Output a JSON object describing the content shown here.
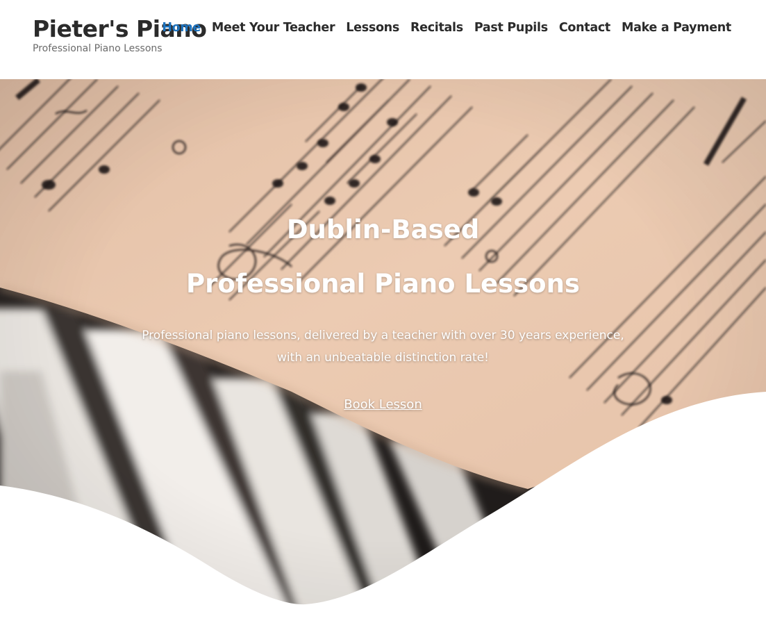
{
  "site": {
    "title": "Pieter's Piano",
    "tagline": "Professional Piano Lessons"
  },
  "nav": {
    "items": [
      {
        "label": "Home",
        "active": true
      },
      {
        "label": "Meet Your Teacher"
      },
      {
        "label": "Lessons"
      },
      {
        "label": "Recitals"
      },
      {
        "label": "Past Pupils"
      },
      {
        "label": "Contact"
      },
      {
        "label": "Make a Payment"
      }
    ]
  },
  "hero": {
    "heading_line1": "Dublin-Based",
    "heading_line2": "Professional Piano Lessons",
    "text": "Professional piano lessons, delivered by a teacher with over 30 years experience, with an unbeatable distinction rate!",
    "cta_label": "Book Lesson",
    "image_subject": "sheet music on a piano"
  },
  "colors": {
    "accent": "#1e73be",
    "text": "#2b2b2b",
    "tagline": "#6b6b6b",
    "paper": "#eac9b0"
  }
}
